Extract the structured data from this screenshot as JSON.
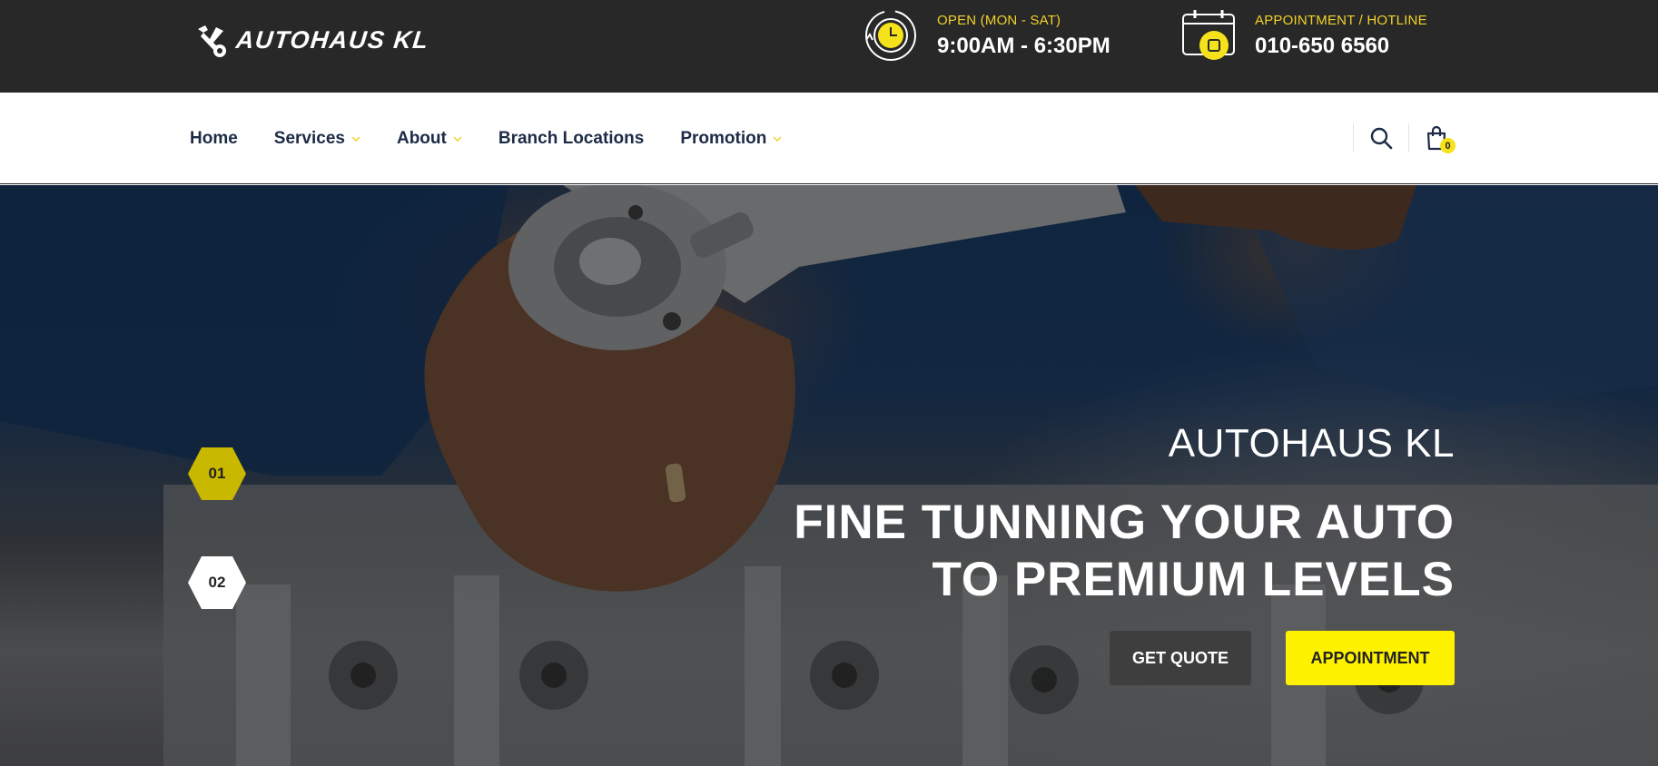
{
  "brand": {
    "name": "AUTOHAUS KL"
  },
  "header": {
    "hours": {
      "label": "OPEN (MON - SAT)",
      "value": "9:00AM - 6:30PM",
      "icon": "clock-icon"
    },
    "hotline": {
      "label": "APPOINTMENT / HOTLINE",
      "value": "010-650 6560",
      "icon": "calendar-icon"
    }
  },
  "nav": {
    "items": [
      {
        "label": "Home",
        "has_dropdown": false
      },
      {
        "label": "Services",
        "has_dropdown": true
      },
      {
        "label": "About",
        "has_dropdown": true
      },
      {
        "label": "Branch Locations",
        "has_dropdown": false
      },
      {
        "label": "Promotion",
        "has_dropdown": true
      }
    ],
    "cart_count": "0"
  },
  "hero": {
    "eyebrow": "AUTOHAUS KL",
    "title_line1": "FINE TUNNING YOUR AUTO",
    "title_line2": "TO PREMIUM LEVELS",
    "slides": [
      "01",
      "02"
    ],
    "active_slide": "01",
    "buttons": {
      "quote": "GET QUOTE",
      "appointment": "APPOINTMENT"
    }
  },
  "colors": {
    "accent": "#fff200",
    "dark": "#282828",
    "nav_text": "#1d2b46",
    "active_slide": "#c9b800"
  }
}
